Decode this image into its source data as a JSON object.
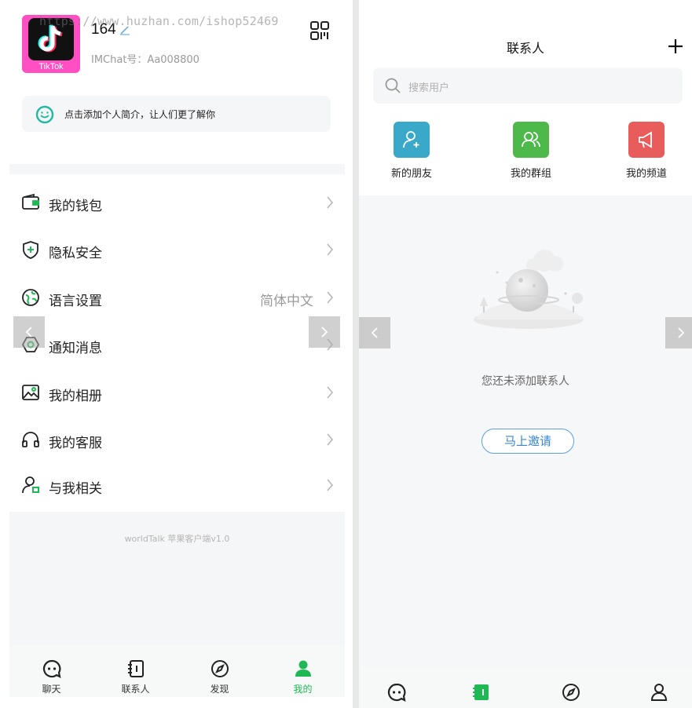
{
  "left_panel": {
    "profile": {
      "avatar_caption": "TikTok",
      "username": "164",
      "im_id": "IMChat号：Aa008800",
      "watermark": "https://www.huzhan.com/ishop52469"
    },
    "bio_prompt": "点击添加个人简介，让人们更了解你",
    "menu": [
      {
        "label": "我的钱包",
        "icon": "wallet-icon",
        "value": ""
      },
      {
        "label": "隐私安全",
        "icon": "shield-icon",
        "value": ""
      },
      {
        "label": "语言设置",
        "icon": "language-icon",
        "value": "简体中文"
      },
      {
        "label": "通知消息",
        "icon": "notification-icon",
        "value": ""
      },
      {
        "label": "我的相册",
        "icon": "album-icon",
        "value": ""
      },
      {
        "label": "我的客服",
        "icon": "headset-icon",
        "value": ""
      },
      {
        "label": "与我相关",
        "icon": "user-related-icon",
        "value": ""
      }
    ],
    "version": "worldTalk 苹果客户端v1.0",
    "tabs": [
      {
        "label": "聊天",
        "icon": "chat-icon",
        "active": false
      },
      {
        "label": "联系人",
        "icon": "contacts-icon",
        "active": false
      },
      {
        "label": "发现",
        "icon": "compass-icon",
        "active": false
      },
      {
        "label": "我的",
        "icon": "profile-icon",
        "active": true
      }
    ]
  },
  "right_panel": {
    "title": "联系人",
    "search_placeholder": "搜索用户",
    "quick_actions": [
      {
        "label": "新的朋友",
        "icon": "add-friend-icon",
        "color": "#39a8c9"
      },
      {
        "label": "我的群组",
        "icon": "group-icon",
        "color": "#4cb94a"
      },
      {
        "label": "我的频道",
        "icon": "megaphone-icon",
        "color": "#e85c5c"
      }
    ],
    "empty_text": "您还未添加联系人",
    "invite_button": "马上邀请",
    "tabs": [
      {
        "icon": "chat-icon"
      },
      {
        "icon": "contacts-icon"
      },
      {
        "icon": "compass-icon"
      },
      {
        "icon": "profile-icon"
      }
    ]
  },
  "colors": {
    "accent_green": "#1fb855",
    "link_blue": "#3a86d6",
    "panel_bg": "#f5f6f8"
  }
}
